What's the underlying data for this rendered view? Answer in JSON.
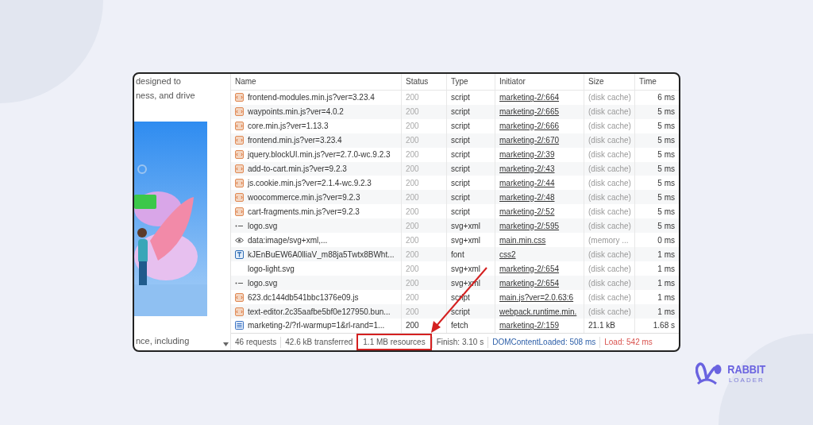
{
  "left_pane": {
    "texts": [
      "designed to",
      "ness, and drive",
      "nce, including"
    ]
  },
  "network_table": {
    "columns": [
      "Name",
      "Status",
      "Type",
      "Initiator",
      "Size",
      "Time"
    ],
    "rows": [
      {
        "kind": "script",
        "name": "frontend-modules.min.js?ver=3.23.4",
        "status": "200",
        "type": "script",
        "initiator": "marketing-2/:664",
        "size": "(disk cache)",
        "time": "6 ms",
        "dimmed": true
      },
      {
        "kind": "script",
        "name": "waypoints.min.js?ver=4.0.2",
        "status": "200",
        "type": "script",
        "initiator": "marketing-2/:665",
        "size": "(disk cache)",
        "time": "5 ms",
        "dimmed": true
      },
      {
        "kind": "script",
        "name": "core.min.js?ver=1.13.3",
        "status": "200",
        "type": "script",
        "initiator": "marketing-2/:666",
        "size": "(disk cache)",
        "time": "5 ms",
        "dimmed": true
      },
      {
        "kind": "script",
        "name": "frontend.min.js?ver=3.23.4",
        "status": "200",
        "type": "script",
        "initiator": "marketing-2/:670",
        "size": "(disk cache)",
        "time": "5 ms",
        "dimmed": true
      },
      {
        "kind": "script",
        "name": "jquery.blockUI.min.js?ver=2.7.0-wc.9.2.3",
        "status": "200",
        "type": "script",
        "initiator": "marketing-2/:39",
        "size": "(disk cache)",
        "time": "5 ms",
        "dimmed": true
      },
      {
        "kind": "script",
        "name": "add-to-cart.min.js?ver=9.2.3",
        "status": "200",
        "type": "script",
        "initiator": "marketing-2/:43",
        "size": "(disk cache)",
        "time": "5 ms",
        "dimmed": true
      },
      {
        "kind": "script",
        "name": "js.cookie.min.js?ver=2.1.4-wc.9.2.3",
        "status": "200",
        "type": "script",
        "initiator": "marketing-2/:44",
        "size": "(disk cache)",
        "time": "5 ms",
        "dimmed": true
      },
      {
        "kind": "script",
        "name": "woocommerce.min.js?ver=9.2.3",
        "status": "200",
        "type": "script",
        "initiator": "marketing-2/:48",
        "size": "(disk cache)",
        "time": "5 ms",
        "dimmed": true
      },
      {
        "kind": "script",
        "name": "cart-fragments.min.js?ver=9.2.3",
        "status": "200",
        "type": "script",
        "initiator": "marketing-2/:52",
        "size": "(disk cache)",
        "time": "5 ms",
        "dimmed": true
      },
      {
        "kind": "svg",
        "name": "logo.svg",
        "status": "200",
        "type": "svg+xml",
        "initiator": "marketing-2/:595",
        "size": "(disk cache)",
        "time": "5 ms",
        "dimmed": true
      },
      {
        "name": "data:image/svg+xml,...",
        "status": "200",
        "type": "svg+xml",
        "initiator": "main.min.css",
        "size": "(memory ...",
        "time": "0 ms",
        "dimmed": true
      },
      {
        "kind": "font",
        "name": "kJEnBuEW6A0lliaV_m88ja5Twtx8BWht...",
        "status": "200",
        "type": "font",
        "initiator": "css2",
        "size": "(disk cache)",
        "time": "1 ms",
        "dimmed": true
      },
      {
        "kind": "blank",
        "name": "logo-light.svg",
        "status": "200",
        "type": "svg+xml",
        "initiator": "marketing-2/:654",
        "size": "(disk cache)",
        "time": "1 ms",
        "dimmed": true
      },
      {
        "kind": "svg",
        "name": "logo.svg",
        "status": "200",
        "type": "svg+xml",
        "initiator": "marketing-2/:654",
        "size": "(disk cache)",
        "time": "1 ms",
        "dimmed": true
      },
      {
        "kind": "script",
        "name": "623.dc144db541bbc1376e09.js",
        "status": "200",
        "type": "script",
        "initiator": "main.js?ver=2.0.63:6",
        "size": "(disk cache)",
        "time": "1 ms",
        "dimmed": true
      },
      {
        "kind": "script",
        "name": "text-editor.2c35aafbe5bf0e127950.bun...",
        "status": "200",
        "type": "script",
        "initiator": "webpack.runtime.min.",
        "size": "(disk cache)",
        "time": "1 ms",
        "dimmed": true
      },
      {
        "kind": "document",
        "name": "marketing-2/?rl-warmup=1&rl-rand=1...",
        "status": "200",
        "type": "fetch",
        "initiator": "marketing-2/:159",
        "size": "21.1 kB",
        "time": "1.68 s",
        "dimmed": false
      }
    ]
  },
  "status_bar": [
    {
      "text": "46 requests",
      "highlighted": false
    },
    {
      "text": "42.6 kB transferred",
      "highlighted": false
    },
    {
      "text": "1.1 MB resources",
      "highlighted": true
    },
    {
      "text": "Finish: 3.10 s",
      "highlighted": false
    },
    {
      "text": "DOMContentLoaded: 508 ms",
      "color": "#2d5fa8",
      "highlighted": false
    },
    {
      "text": "Load: 542 ms",
      "color": "#d9534f",
      "highlighted": false
    }
  ],
  "logo": {
    "line1": "RABBIT",
    "line2": "LOADER"
  }
}
